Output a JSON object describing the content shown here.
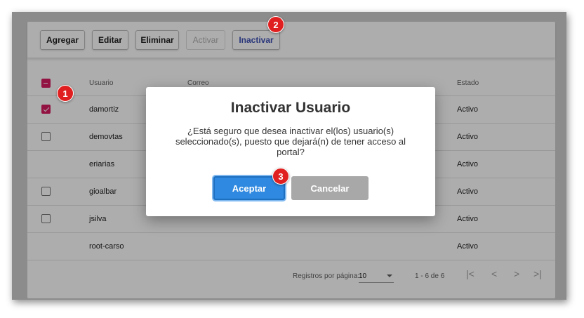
{
  "toolbar": {
    "add_label": "Agregar",
    "edit_label": "Editar",
    "delete_label": "Eliminar",
    "activate_label": "Activar",
    "deactivate_label": "Inactivar"
  },
  "table": {
    "headers": {
      "user": "Usuario",
      "email": "Correo",
      "status": "Estado"
    },
    "rows": [
      {
        "user": "damortiz",
        "status": "Activo",
        "checkbox": "checked"
      },
      {
        "user": "demovtas",
        "status": "Activo",
        "checkbox": "unchecked"
      },
      {
        "user": "eriarias",
        "status": "Activo",
        "checkbox": "none"
      },
      {
        "user": "gioalbar",
        "status": "Activo",
        "checkbox": "unchecked"
      },
      {
        "user": "jsilva",
        "status": "Activo",
        "checkbox": "unchecked"
      },
      {
        "user": "root-carso",
        "status": "Activo",
        "checkbox": "none"
      }
    ]
  },
  "footer": {
    "rows_per_page_label": "Registros por página:",
    "rows_per_page_value": "10",
    "range_label": "1 - 6 de 6",
    "first_icon": "first-page-icon",
    "prev_icon": "chevron-left-icon",
    "next_icon": "chevron-right-icon",
    "last_icon": "last-page-icon"
  },
  "dialog": {
    "title": "Inactivar Usuario",
    "message": "¿Está seguro que desea inactivar el(los) usuario(s) seleccionado(s), puesto que dejará(n) de tener acceso al portal?",
    "accept_label": "Aceptar",
    "cancel_label": "Cancelar"
  },
  "annotations": {
    "step1": "1",
    "step2": "2",
    "step3": "3"
  },
  "colors": {
    "accent_primary": "#2f89e0",
    "checkbox_selected": "#d81b60",
    "annotation_badge": "#e02020"
  }
}
